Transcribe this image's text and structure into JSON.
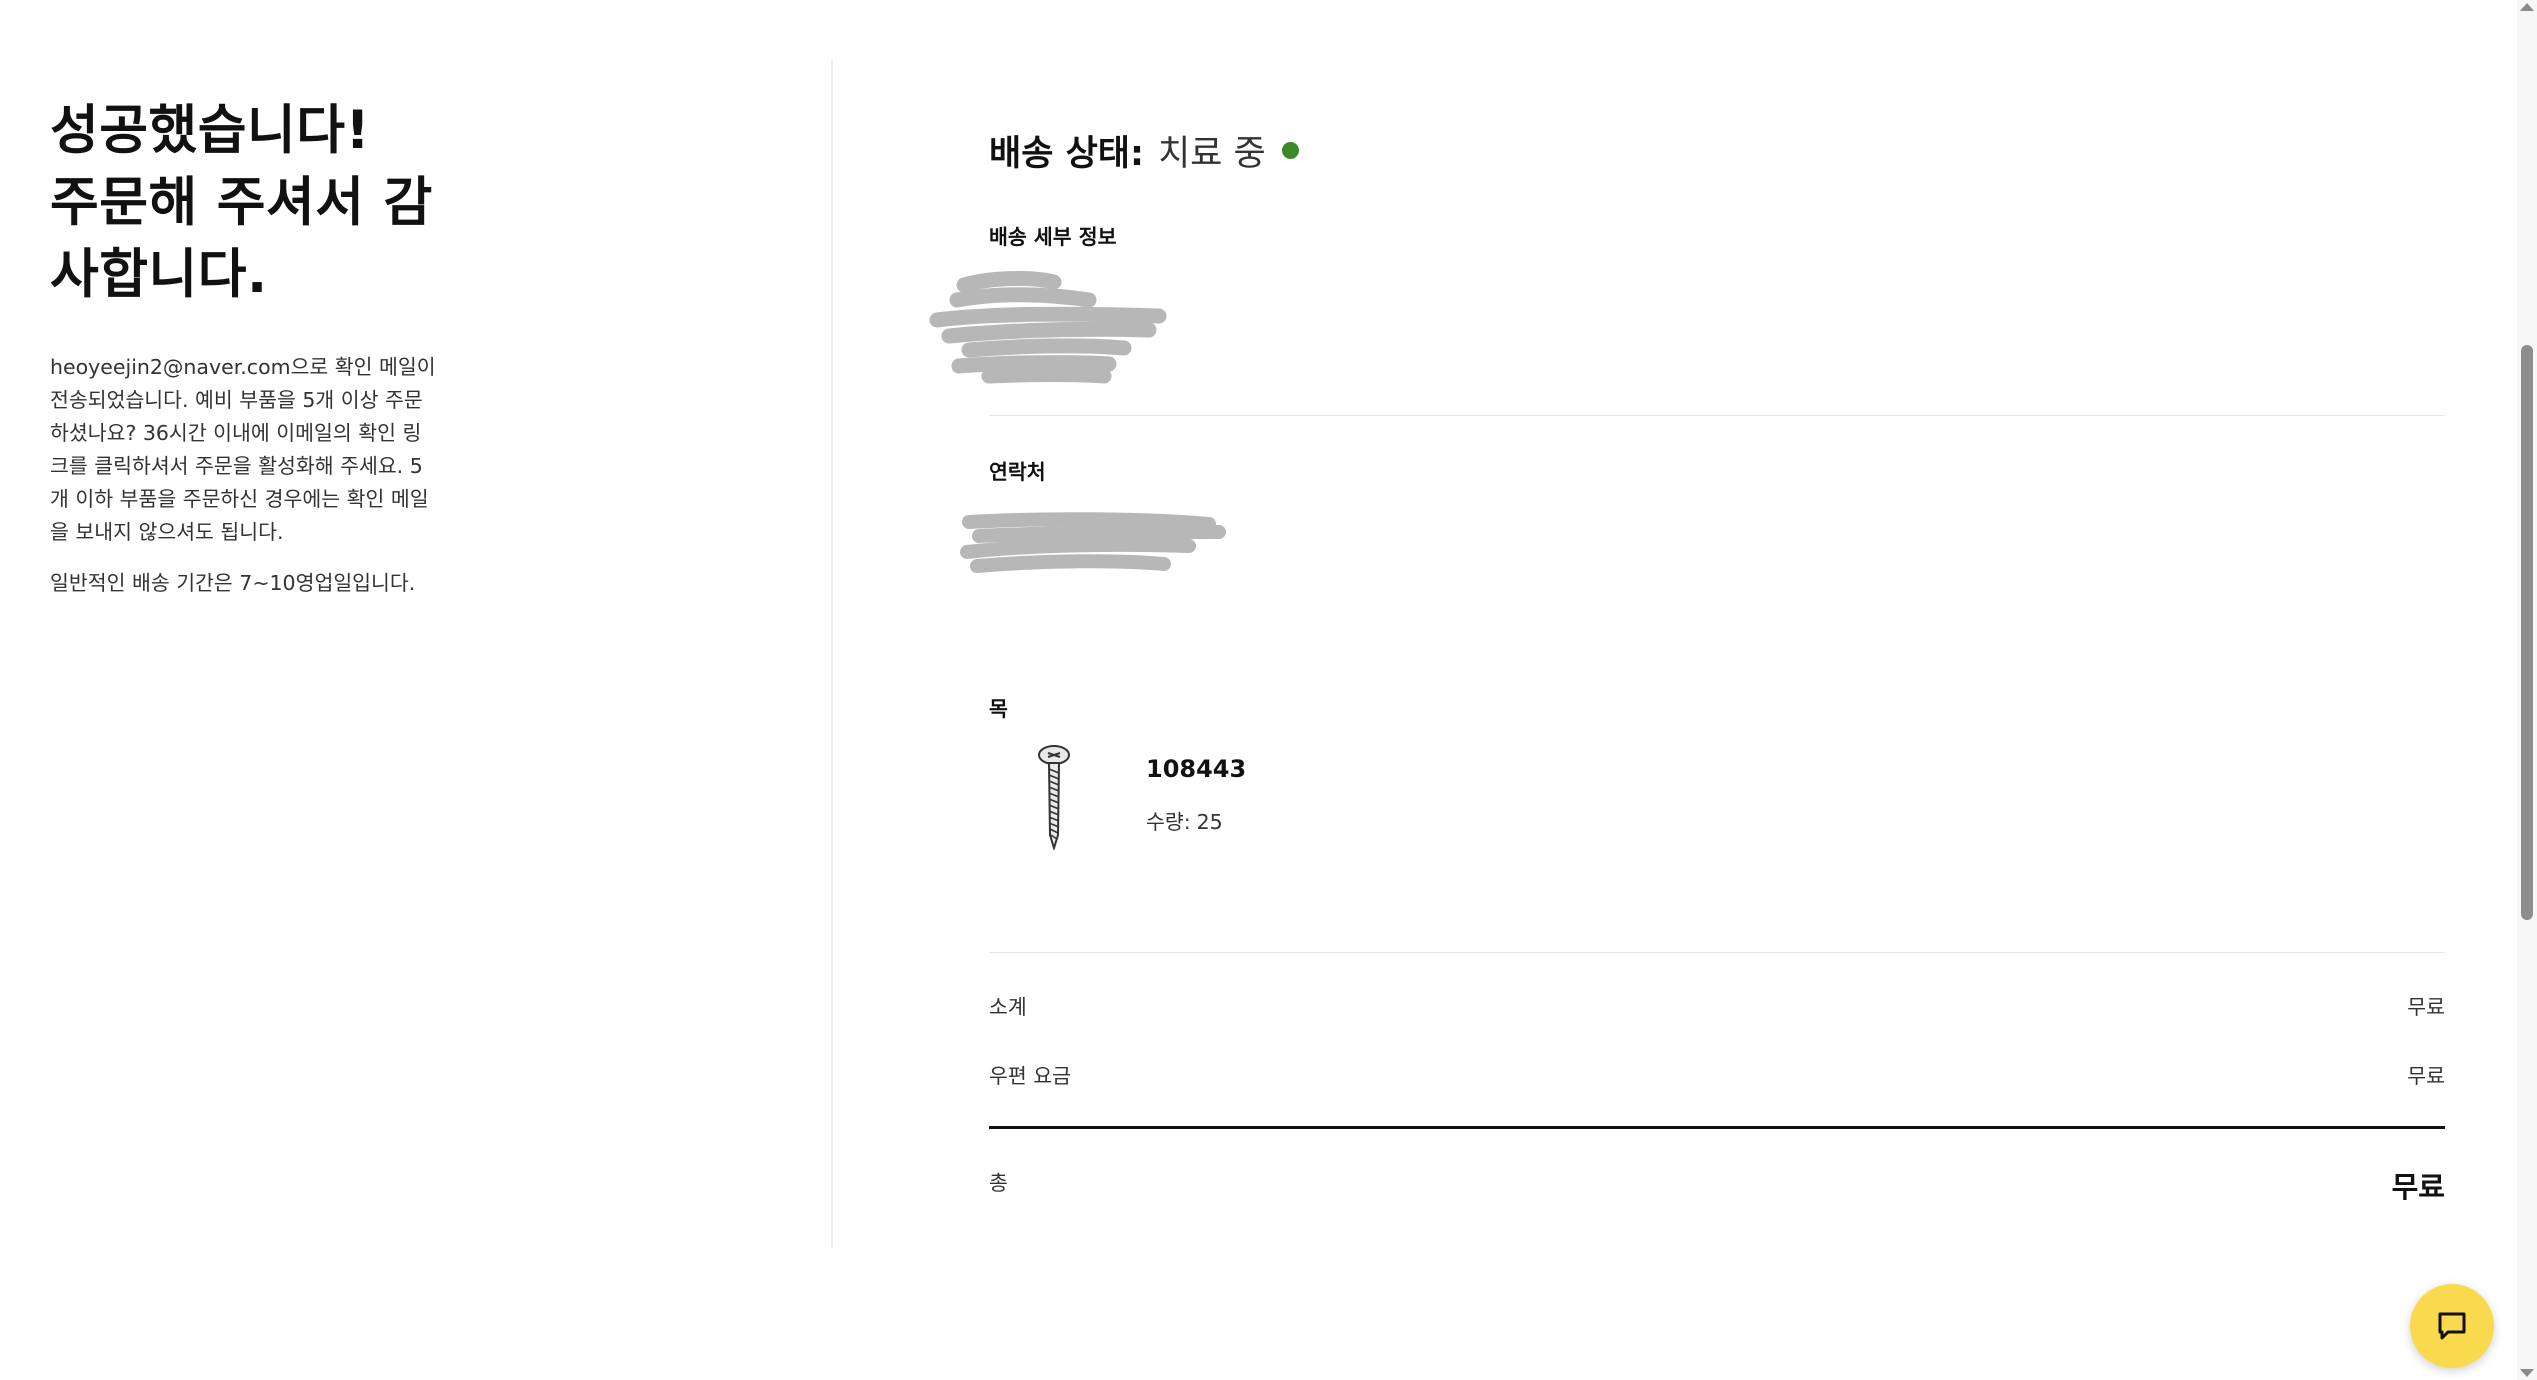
{
  "confirmation": {
    "title_lines": [
      "성공했습니다!",
      "주문해 주셔서 감",
      "사합니다."
    ],
    "message_lines": [
      "heoyeejin2@naver.com으로 확인 메일이",
      "전송되었습니다. 예비 부품을 5개 이상 주문",
      "하셨나요? 36시간 이내에 이메일의 확인 링",
      "크를 클릭하셔서 주문을 활성화해 주세요. 5",
      "개 이하 부품을 주문하신 경우에는 확인 메일",
      "을 보내지 않으셔도 됩니다."
    ],
    "delivery_note": "일반적인 배송 기간은 7~10영업일입니다."
  },
  "shipping": {
    "status_label": "배송 상태:",
    "status_value": "치료 중",
    "status_color": "#3a8a2b",
    "details_label": "배송 세부 정보",
    "contact_label": "연락처",
    "items_label": "목"
  },
  "items": [
    {
      "name": "108443",
      "quantity_label": "수량:",
      "quantity": "25",
      "icon": "screw-icon"
    }
  ],
  "summary": {
    "subtotal_label": "소계",
    "subtotal_value": "무료",
    "shipping_label": "우편 요금",
    "shipping_value": "무료",
    "total_label": "총",
    "total_value": "무료"
  },
  "chat": {
    "icon": "chat-bubble-icon",
    "color": "#f9d94d"
  }
}
